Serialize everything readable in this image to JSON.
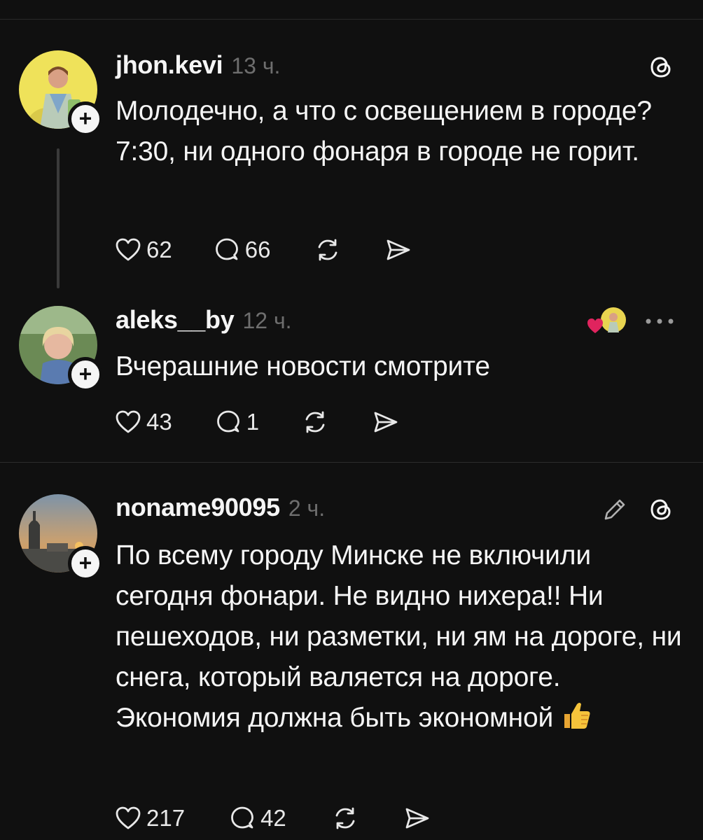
{
  "posts": [
    {
      "username": "jhon.kevi",
      "time": "13 ч.",
      "text": "Молодечно, а что с освещением в городе? 7:30,  ни одного фонаря в городе не горит.",
      "likes": "62",
      "comments": "66",
      "top_icon": "threads-icon"
    },
    {
      "username": "aleks__by",
      "time": "12 ч.",
      "text": "Вчерашние новости смотрите",
      "likes": "43",
      "comments": "1",
      "top_icon": "liked-by-author-avatar"
    },
    {
      "username": "noname90095",
      "time": "2 ч.",
      "text": "По всему городу  Минске не включили сегодня фонари. Не видно нихера!! Ни пешеходов, ни разметки, ни ям на дороге, ни снега, который валяется на дороге. Экономия должна быть экономной",
      "likes": "217",
      "comments": "42",
      "top_icon": "threads-icon"
    }
  ],
  "colors": {
    "background": "#101010",
    "text": "#f5f5f5",
    "muted": "#6e6e6e",
    "divider": "#2c2c2c",
    "like_heart": "#e0245e"
  }
}
